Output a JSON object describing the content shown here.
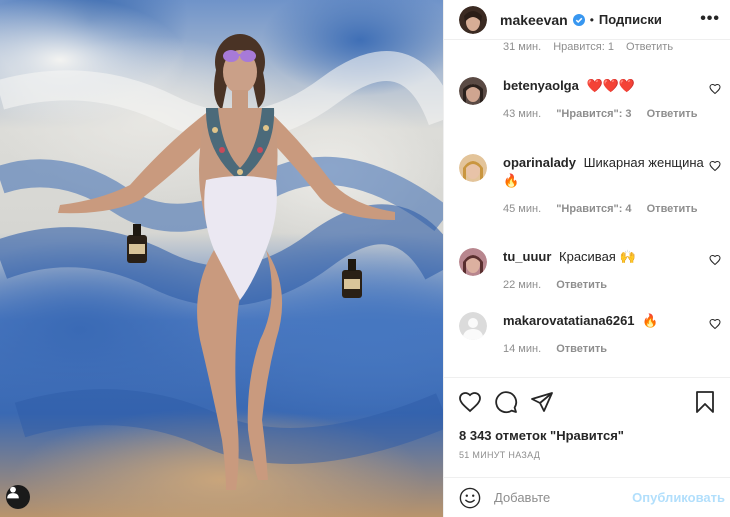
{
  "header": {
    "username": "makeevan",
    "separator": "•",
    "follow_label": "Подписки",
    "more": "•••"
  },
  "partial_comment": {
    "time": "31 мин.",
    "likes": "Нравится: 1",
    "reply": "Ответить"
  },
  "comments": [
    {
      "user": "betenyaolga",
      "text": "❤️❤️❤️",
      "time": "43 мин.",
      "likes": "\"Нравится\": 3",
      "reply": "Ответить"
    },
    {
      "user": "oparinalady",
      "text": "Шикарная женщина 🔥",
      "time": "45 мин.",
      "likes": "\"Нравится\": 4",
      "reply": "Ответить"
    },
    {
      "user": "tu_uuur",
      "text": "Красивая 🙌",
      "time": "22 мин.",
      "likes": "",
      "reply": "Ответить"
    },
    {
      "user": "makarovatatiana6261",
      "text": "🔥",
      "time": "14 мин.",
      "likes": "",
      "reply": "Ответить"
    }
  ],
  "actions": {
    "likes_count": "8 343 отметок \"Нравится\"",
    "posted_ago": "51 МИНУТ НАЗАД"
  },
  "add_comment": {
    "placeholder": "Добавьте",
    "publish_label": "Опубликовать"
  },
  "colors": {
    "verified": "#3897f0",
    "publish_disabled": "#b2dffc",
    "meta_gray": "#8e8e8e",
    "text": "#262626"
  },
  "icons": [
    "verified-icon",
    "more-icon",
    "heart-icon",
    "comment-icon",
    "share-icon",
    "bookmark-icon",
    "emoji-icon",
    "user-icon"
  ]
}
